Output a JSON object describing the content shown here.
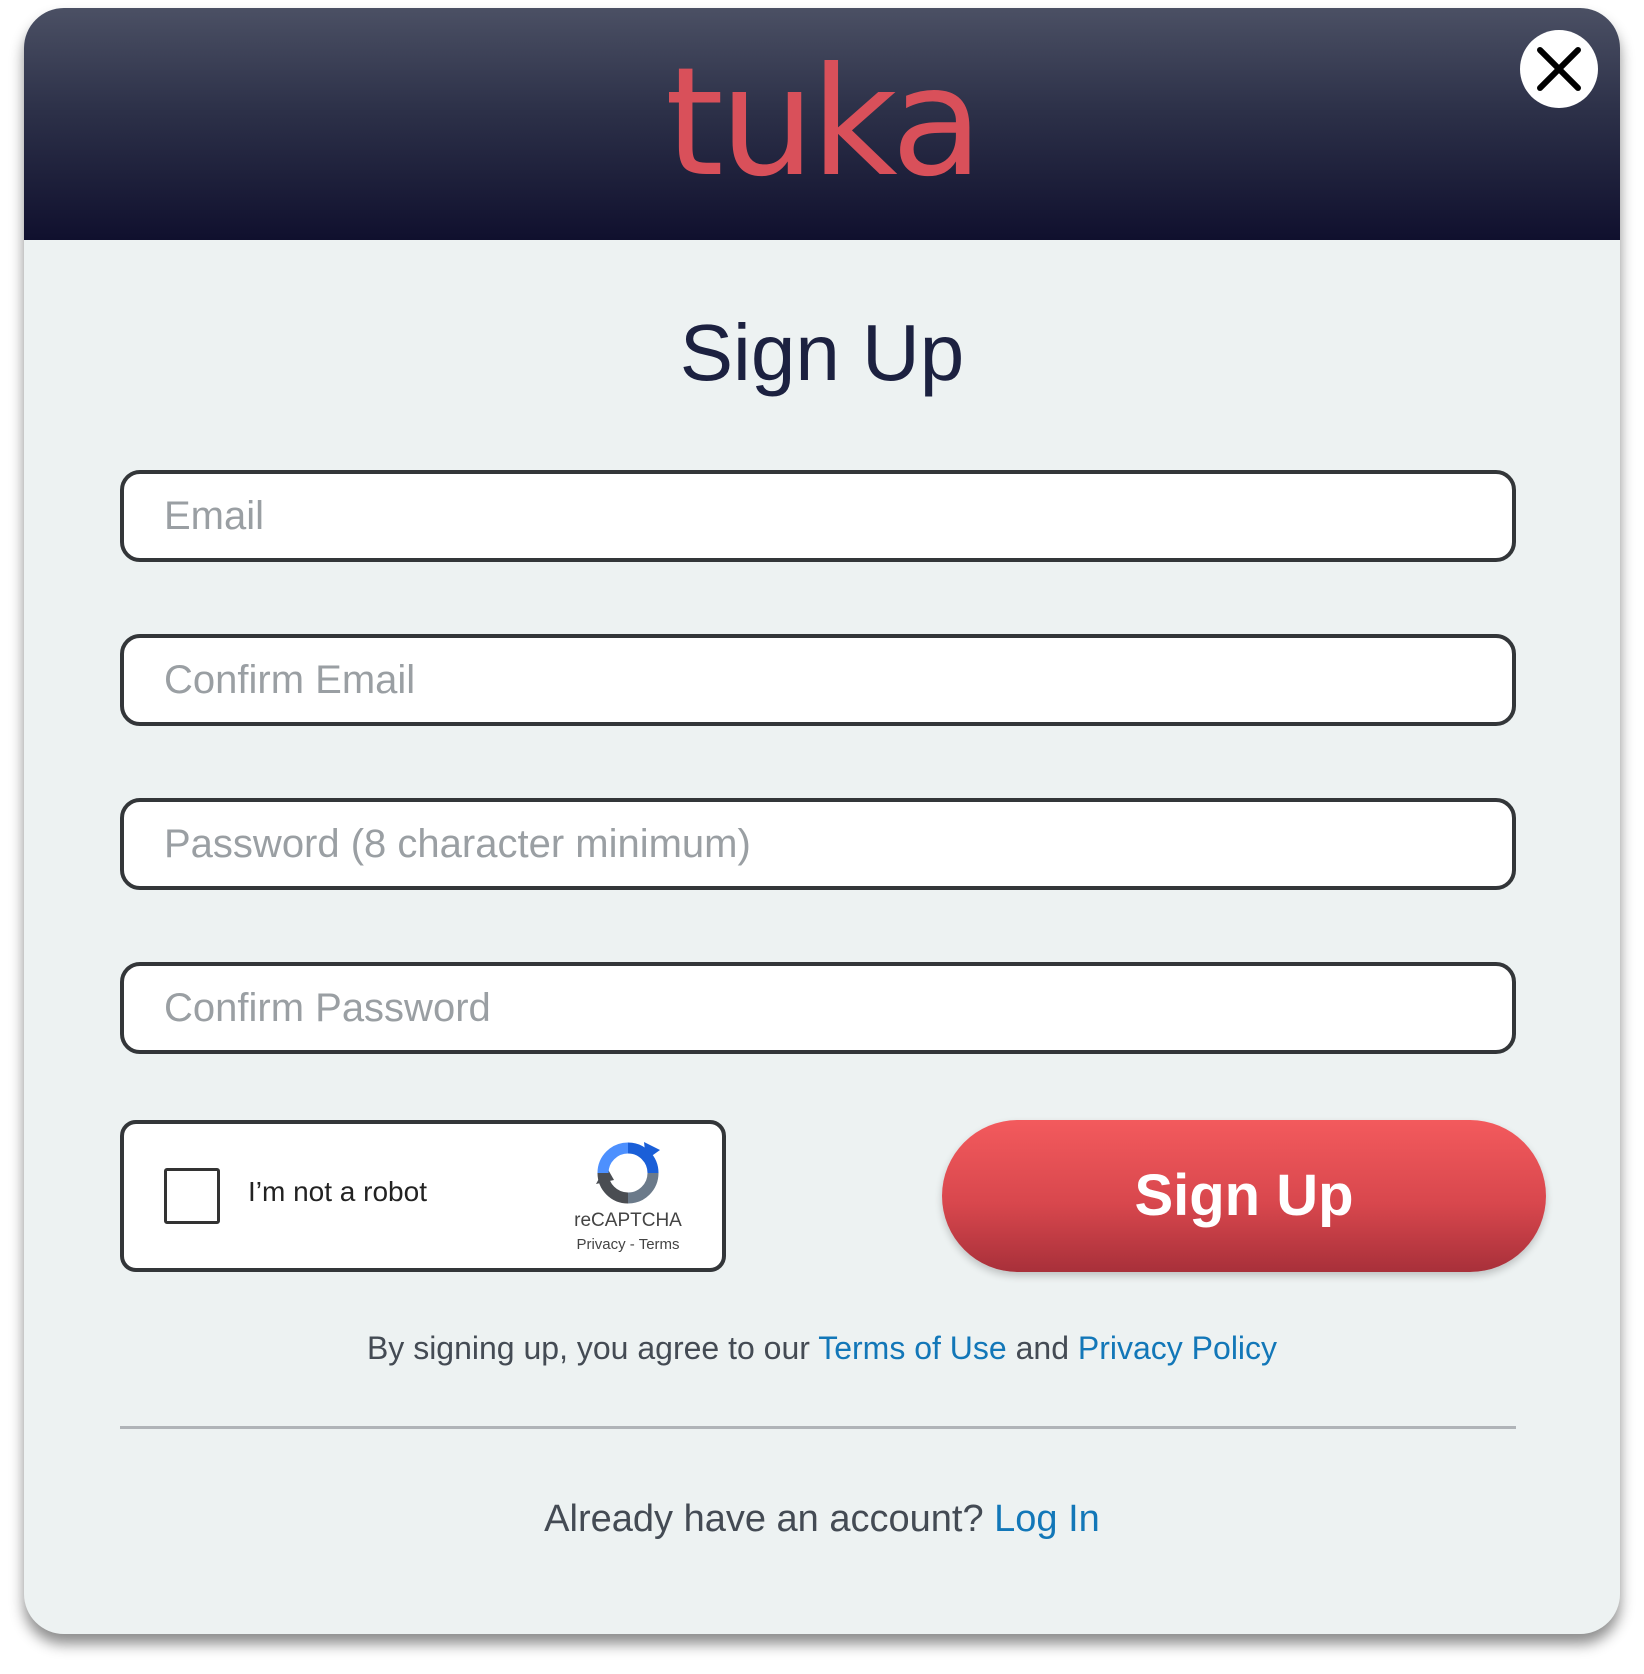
{
  "header": {
    "logo_text": "tuka",
    "close_icon": "close-icon"
  },
  "form": {
    "title": "Sign Up",
    "fields": [
      {
        "placeholder": "Email",
        "value": ""
      },
      {
        "placeholder": "Confirm Email",
        "value": ""
      },
      {
        "placeholder": "Password (8 character minimum)",
        "value": ""
      },
      {
        "placeholder": "Confirm Password",
        "value": ""
      }
    ],
    "captcha": {
      "label": "I’m not a robot",
      "brand": "reCAPTCHA",
      "privacy_label": "Privacy",
      "separator": " - ",
      "terms_label": "Terms",
      "icon": "recaptcha-icon"
    },
    "submit_label": "Sign Up"
  },
  "agreement": {
    "prefix": "By signing up, you agree to our ",
    "terms_label": "Terms of Use",
    "middle": " and ",
    "privacy_label": "Privacy Policy"
  },
  "login": {
    "prompt": "Already have an account? ",
    "link_label": "Log In"
  },
  "colors": {
    "brand_red": "#d9505a",
    "header_dark": "#10102e",
    "link_blue": "#1277b8",
    "background": "#edf2f2"
  }
}
